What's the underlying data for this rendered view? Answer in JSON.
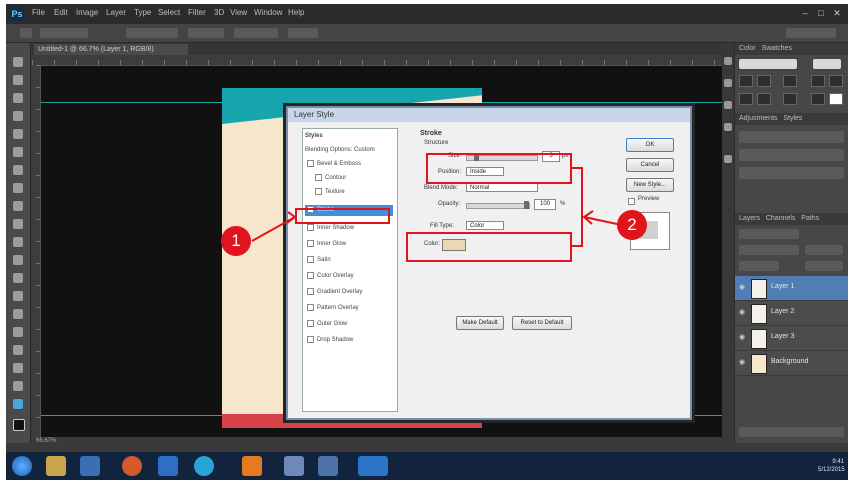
{
  "app": {
    "logo": "Ps"
  },
  "menubar": {
    "items": [
      "File",
      "Edit",
      "Image",
      "Layer",
      "Type",
      "Select",
      "Filter",
      "3D",
      "View",
      "Window",
      "Help"
    ],
    "window_buttons": [
      "–",
      "□",
      "✕"
    ]
  },
  "document": {
    "tab_label": "Untitled-1 @ 66.7% (Layer 1, RGB/8)"
  },
  "status": {
    "zoom": "66.67%"
  },
  "panels": {
    "headers": [
      "Color",
      "Swatches",
      "Adjustments",
      "Styles",
      "Layers",
      "Channels",
      "Paths"
    ],
    "layers": [
      "Layer 1",
      "Layer 2",
      "Layer 3",
      "Background"
    ]
  },
  "dialog": {
    "title": "Layer Style",
    "styles": [
      "Styles",
      "Blending Options: Custom",
      "Bevel & Emboss",
      "Contour",
      "Texture",
      "Stroke",
      "Inner Shadow",
      "Inner Glow",
      "Satin",
      "Color Overlay",
      "Gradient Overlay",
      "Pattern Overlay",
      "Outer Glow",
      "Drop Shadow"
    ],
    "selected_style": "Stroke",
    "section_title": "Stroke",
    "section_subtitle": "Structure",
    "size_label": "Size:",
    "size_value": "3",
    "size_unit": "px",
    "position_label": "Position:",
    "position_value": "Inside",
    "blend_mode_label": "Blend Mode:",
    "blend_mode_value": "Normal",
    "opacity_label": "Opacity:",
    "opacity_value": "100",
    "opacity_unit": "%",
    "fill_type_label": "Fill Type:",
    "fill_type_value": "Color",
    "color_label": "Color:",
    "make_default": "Make Default",
    "reset_default": "Reset to Default",
    "buttons": {
      "ok": "OK",
      "cancel": "Cancel",
      "new_style": "New Style...",
      "preview": "Preview"
    },
    "size_fraction": 0.1,
    "opacity_fraction": 1.0
  },
  "annotations": {
    "marker_1": "1",
    "marker_2": "2"
  },
  "taskbar": {
    "clock_time": "9:41",
    "clock_date": "5/12/2015"
  },
  "colors": {
    "accent": "#3d8fe0",
    "annotation_red": "#e0141d",
    "teal": "#17a6ad",
    "cream": "#f6e6cd",
    "doc_red": "#d8434a",
    "taskbar": "#12243d"
  }
}
